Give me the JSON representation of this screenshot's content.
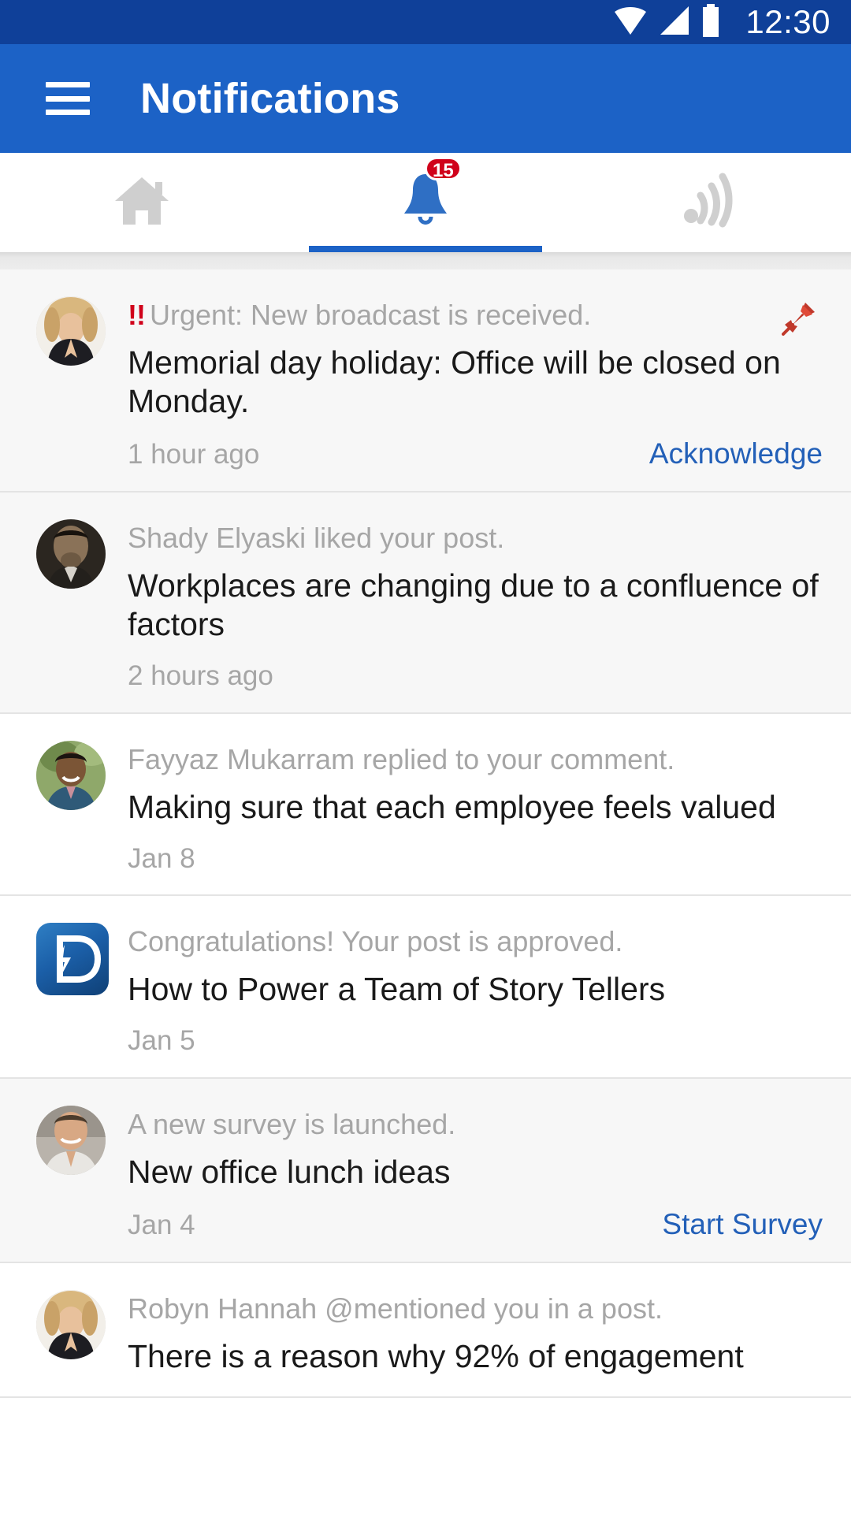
{
  "status_bar": {
    "time": "12:30",
    "icons": [
      "wifi-icon",
      "cell-signal-icon",
      "battery-icon"
    ],
    "background": "#0f4099"
  },
  "app_bar": {
    "menu_icon": "hamburger-menu-icon",
    "title": "Notifications",
    "background": "#1c62c6"
  },
  "tabs": {
    "active_index": 1,
    "indicator_color": "#1c62c6",
    "items": [
      {
        "name": "home",
        "icon": "home-icon",
        "badge": "",
        "active": false
      },
      {
        "name": "notifications",
        "icon": "bell-icon",
        "badge": "15",
        "active": true
      },
      {
        "name": "broadcast",
        "icon": "broadcast-icon",
        "badge": "",
        "active": false
      }
    ]
  },
  "badge_color": "#d0021b",
  "link_color": "#2360b8",
  "notifications": [
    {
      "avatar": "woman-blonde-avatar",
      "urgent_marker": "!!",
      "subtitle": "Urgent: New broadcast is received.",
      "title": "Memorial day holiday: Office will be closed on Monday.",
      "time": "1 hour ago",
      "action": "Acknowledge",
      "pinned": true
    },
    {
      "avatar": "man-dark-avatar",
      "urgent_marker": "",
      "subtitle": "Shady Elyaski liked your post.",
      "title": "Workplaces are changing due to a confluence of factors",
      "time": "2 hours ago",
      "action": "",
      "pinned": false
    },
    {
      "avatar": "man-outdoor-avatar",
      "urgent_marker": "",
      "subtitle": "Fayyaz Mukarram replied to your comment.",
      "title": "Making sure that each employee feels valued",
      "time": "Jan 8",
      "action": "",
      "pinned": false
    },
    {
      "avatar": "app-logo-d-tile",
      "urgent_marker": "",
      "subtitle": "Congratulations! Your post is approved.",
      "title": "How to Power a Team of Story Tellers",
      "time": "Jan 5",
      "action": "",
      "pinned": false
    },
    {
      "avatar": "man-smiling-avatar",
      "urgent_marker": "",
      "subtitle": "A new survey is launched.",
      "title": "New office lunch ideas",
      "time": "Jan 4",
      "action": "Start Survey",
      "pinned": false
    },
    {
      "avatar": "woman-blonde-avatar",
      "urgent_marker": "",
      "subtitle": "Robyn Hannah @mentioned you in a post.",
      "title": "There is a reason why 92% of engagement",
      "time": "",
      "action": "",
      "pinned": false
    }
  ]
}
